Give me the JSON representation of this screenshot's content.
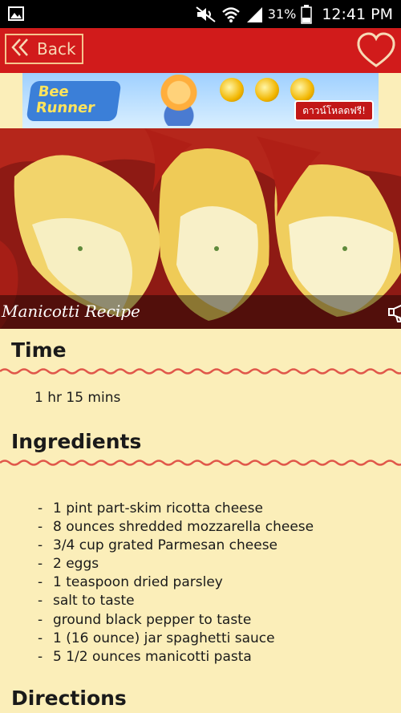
{
  "status_bar": {
    "battery_percent": "31%",
    "time": "12:41 PM"
  },
  "app_bar": {
    "back_label": "Back"
  },
  "banner_ad": {
    "brand": "Bee Runner",
    "cta": "ดาวน์โหลดฟรี!"
  },
  "recipe": {
    "title": "Manicotti Recipe",
    "sections": {
      "time_heading": "Time",
      "time_value": "1 hr 15 mins",
      "ingredients_heading": "Ingredients",
      "directions_heading": "Directions"
    },
    "ingredients": [
      "1 pint part-skim ricotta cheese",
      "8 ounces shredded mozzarella cheese",
      "3/4 cup grated Parmesan cheese",
      "2 eggs",
      "1 teaspoon dried parsley",
      "salt to taste",
      "ground black pepper to taste",
      "1 (16 ounce) jar spaghetti sauce",
      "5 1/2 ounces manicotti pasta"
    ]
  },
  "colors": {
    "app_bar": "#D11B1B",
    "background": "#FBEEB9",
    "wave_divider": "#E0574A"
  },
  "icons": [
    "image-icon",
    "mute-icon",
    "wifi-icon",
    "signal-icon",
    "battery-icon",
    "chevron-left-double-icon",
    "heart-icon",
    "speaker-icon"
  ]
}
